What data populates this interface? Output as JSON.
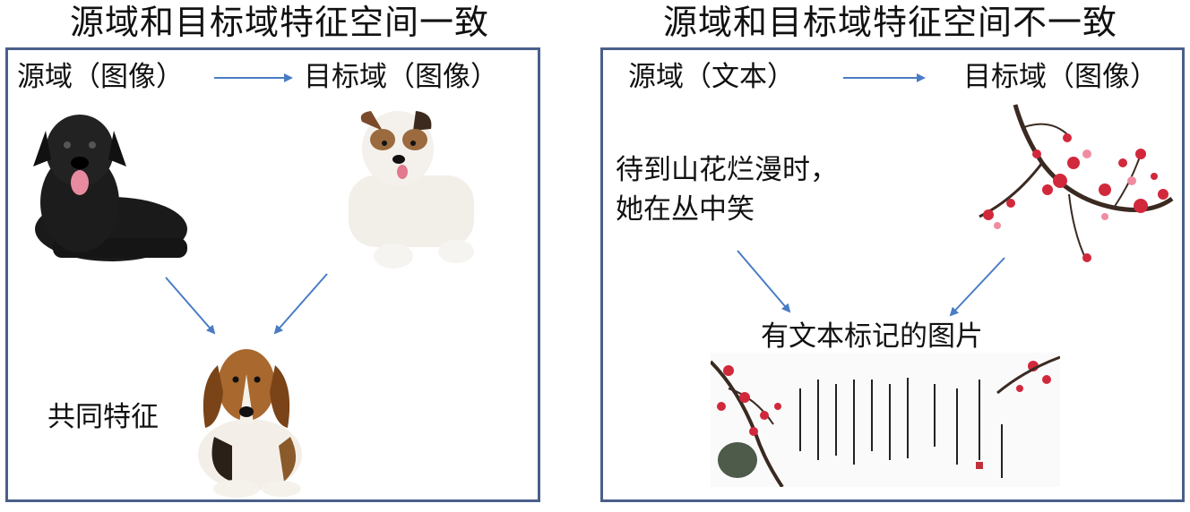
{
  "left": {
    "title": "源域和目标域特征空间一致",
    "source_label": "源域（图像）",
    "target_label": "目标域（图像）",
    "shared_label": "共同特征"
  },
  "right": {
    "title": "源域和目标域特征空间不一致",
    "source_label": "源域（文本）",
    "target_label": "目标域（图像）",
    "poem_line1": "待到山花烂漫时，",
    "poem_line2": "她在丛中笑",
    "result_label": "有文本标记的图片"
  },
  "colors": {
    "border": "#4a5f8a",
    "arrow": "#4a7cc4",
    "blossom": "#d2283c"
  },
  "icons": [
    "black-dog-icon",
    "white-dog-icon",
    "beagle-icon",
    "plum-blossom-icon",
    "calligraphy-scroll-icon"
  ]
}
